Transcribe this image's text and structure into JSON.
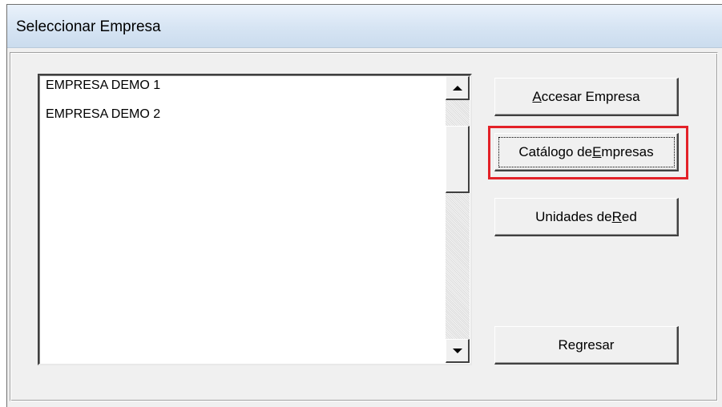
{
  "window": {
    "title": "Seleccionar Empresa"
  },
  "companies": [
    "EMPRESA DEMO 1",
    "EMPRESA DEMO 2"
  ],
  "buttons": {
    "access": {
      "pre": "",
      "key": "A",
      "post": "ccesar Empresa"
    },
    "catalog": {
      "pre": "Catálogo de ",
      "key": "E",
      "post": "mpresas"
    },
    "network": {
      "pre": "Unidades de ",
      "key": "R",
      "post": "ed"
    },
    "back": {
      "pre": "Regresar",
      "key": "",
      "post": ""
    }
  },
  "colors": {
    "highlight": "#e32128",
    "face": "#f0f0f0",
    "titlebar": "#d6e4f3"
  },
  "icons": {
    "scroll_up": "triangle-up",
    "scroll_down": "triangle-down"
  }
}
